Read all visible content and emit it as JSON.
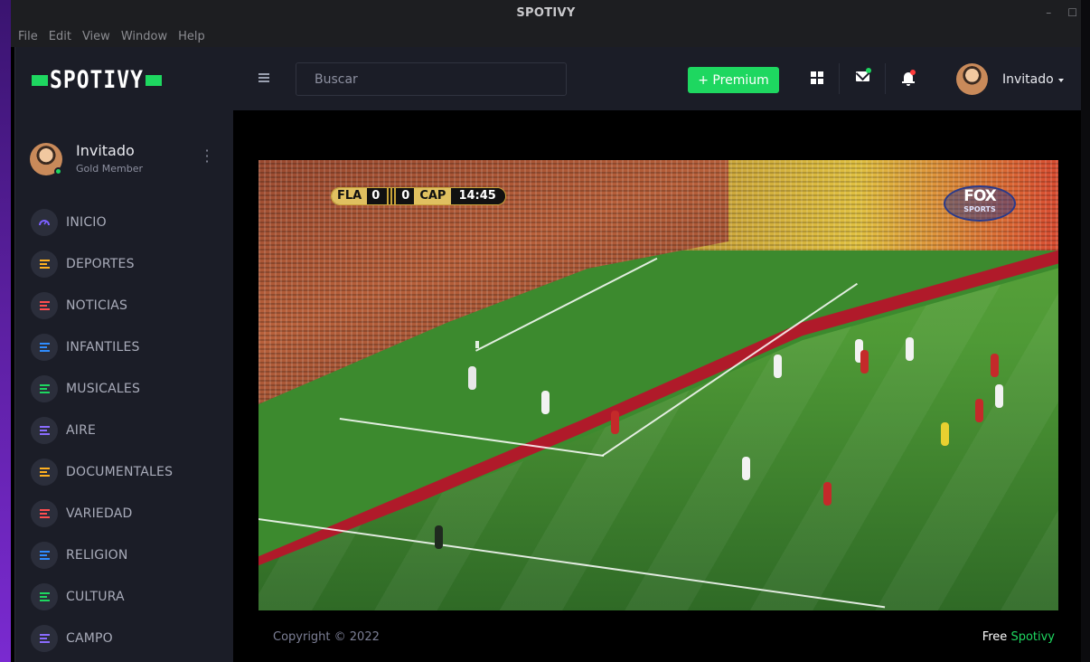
{
  "window": {
    "title": "SPOTIVY",
    "controls": {
      "minimize": "–",
      "maximize": "☐"
    }
  },
  "menu": [
    "File",
    "Edit",
    "View",
    "Window",
    "Help"
  ],
  "logo": {
    "text": "SPOTIVY"
  },
  "profile": {
    "name": "Invitado",
    "tier": "Gold Member"
  },
  "nav": [
    {
      "label": "INICIO",
      "icon": "speedometer-icon",
      "color": "#7b61ff"
    },
    {
      "label": "DEPORTES",
      "icon": "list-icon",
      "color": "#ffb020"
    },
    {
      "label": "NOTICIAS",
      "icon": "list-icon",
      "color": "#ff4d4f"
    },
    {
      "label": "INFANTILES",
      "icon": "list-icon",
      "color": "#2f8cff"
    },
    {
      "label": "MUSICALES",
      "icon": "list-icon",
      "color": "#1ed760"
    },
    {
      "label": "AIRE",
      "icon": "list-icon",
      "color": "#8a6cff"
    },
    {
      "label": "DOCUMENTALES",
      "icon": "list-icon",
      "color": "#ffb020"
    },
    {
      "label": "VARIEDAD",
      "icon": "list-icon",
      "color": "#ff4d4f"
    },
    {
      "label": "RELIGION",
      "icon": "list-icon",
      "color": "#2f8cff"
    },
    {
      "label": "CULTURA",
      "icon": "list-icon",
      "color": "#1ed760"
    },
    {
      "label": "CAMPO",
      "icon": "list-icon",
      "color": "#8a6cff"
    }
  ],
  "topbar": {
    "search_placeholder": "Buscar",
    "premium_label": "+ Premium",
    "user_name": "Invitado",
    "mail_dot_color": "#1ed760",
    "bell_dot_color": "#ff3b3b"
  },
  "video": {
    "home_team": "FLA",
    "home_score": "0",
    "away_score": "0",
    "away_team": "CAP",
    "clock": "14:45",
    "broadcaster": "FOX",
    "broadcaster_sub": "SPORTS"
  },
  "footer": {
    "copyright": "Copyright © 2022",
    "free_label": "Free",
    "brand": "Spotivy"
  },
  "colors": {
    "accent": "#1ed760",
    "sidebar_bg": "#1b1d27",
    "page_bg": "#000000"
  }
}
